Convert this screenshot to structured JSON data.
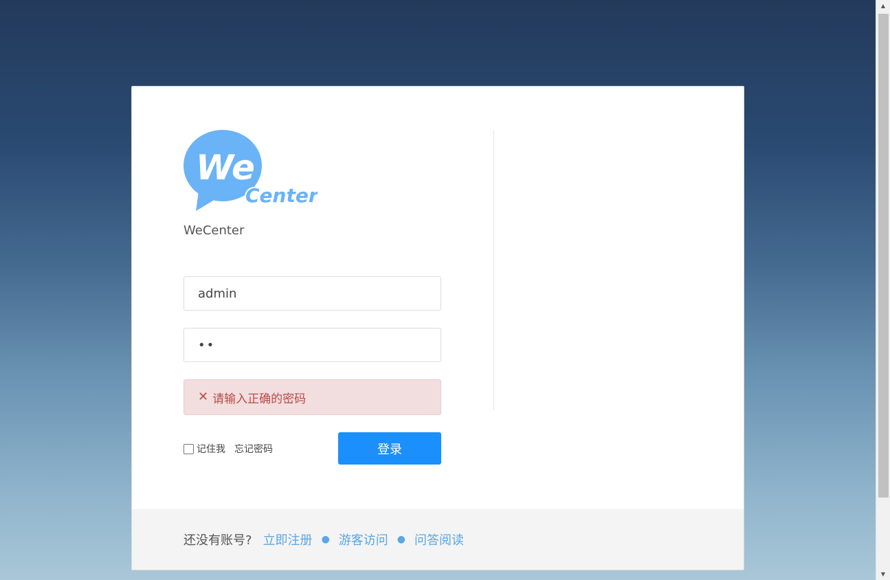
{
  "site": {
    "name": "WeCenter"
  },
  "logo": {
    "we_text": "We",
    "center_text": "Center",
    "color": "#6ab3f6"
  },
  "form": {
    "username_value": "admin",
    "password_masked": "••",
    "error_icon": "close-icon",
    "error_text": "请输入正确的密码",
    "remember_label": "记住我",
    "forgot_label": "忘记密码",
    "login_label": "登录"
  },
  "footer": {
    "prompt": "还没有账号?",
    "links": [
      "立即注册",
      "游客访问",
      "问答阅读"
    ]
  },
  "colors": {
    "primary": "#1b8ffb",
    "error_bg": "#f2dede",
    "error_text": "#b94a48",
    "link": "#5aa6e6"
  }
}
